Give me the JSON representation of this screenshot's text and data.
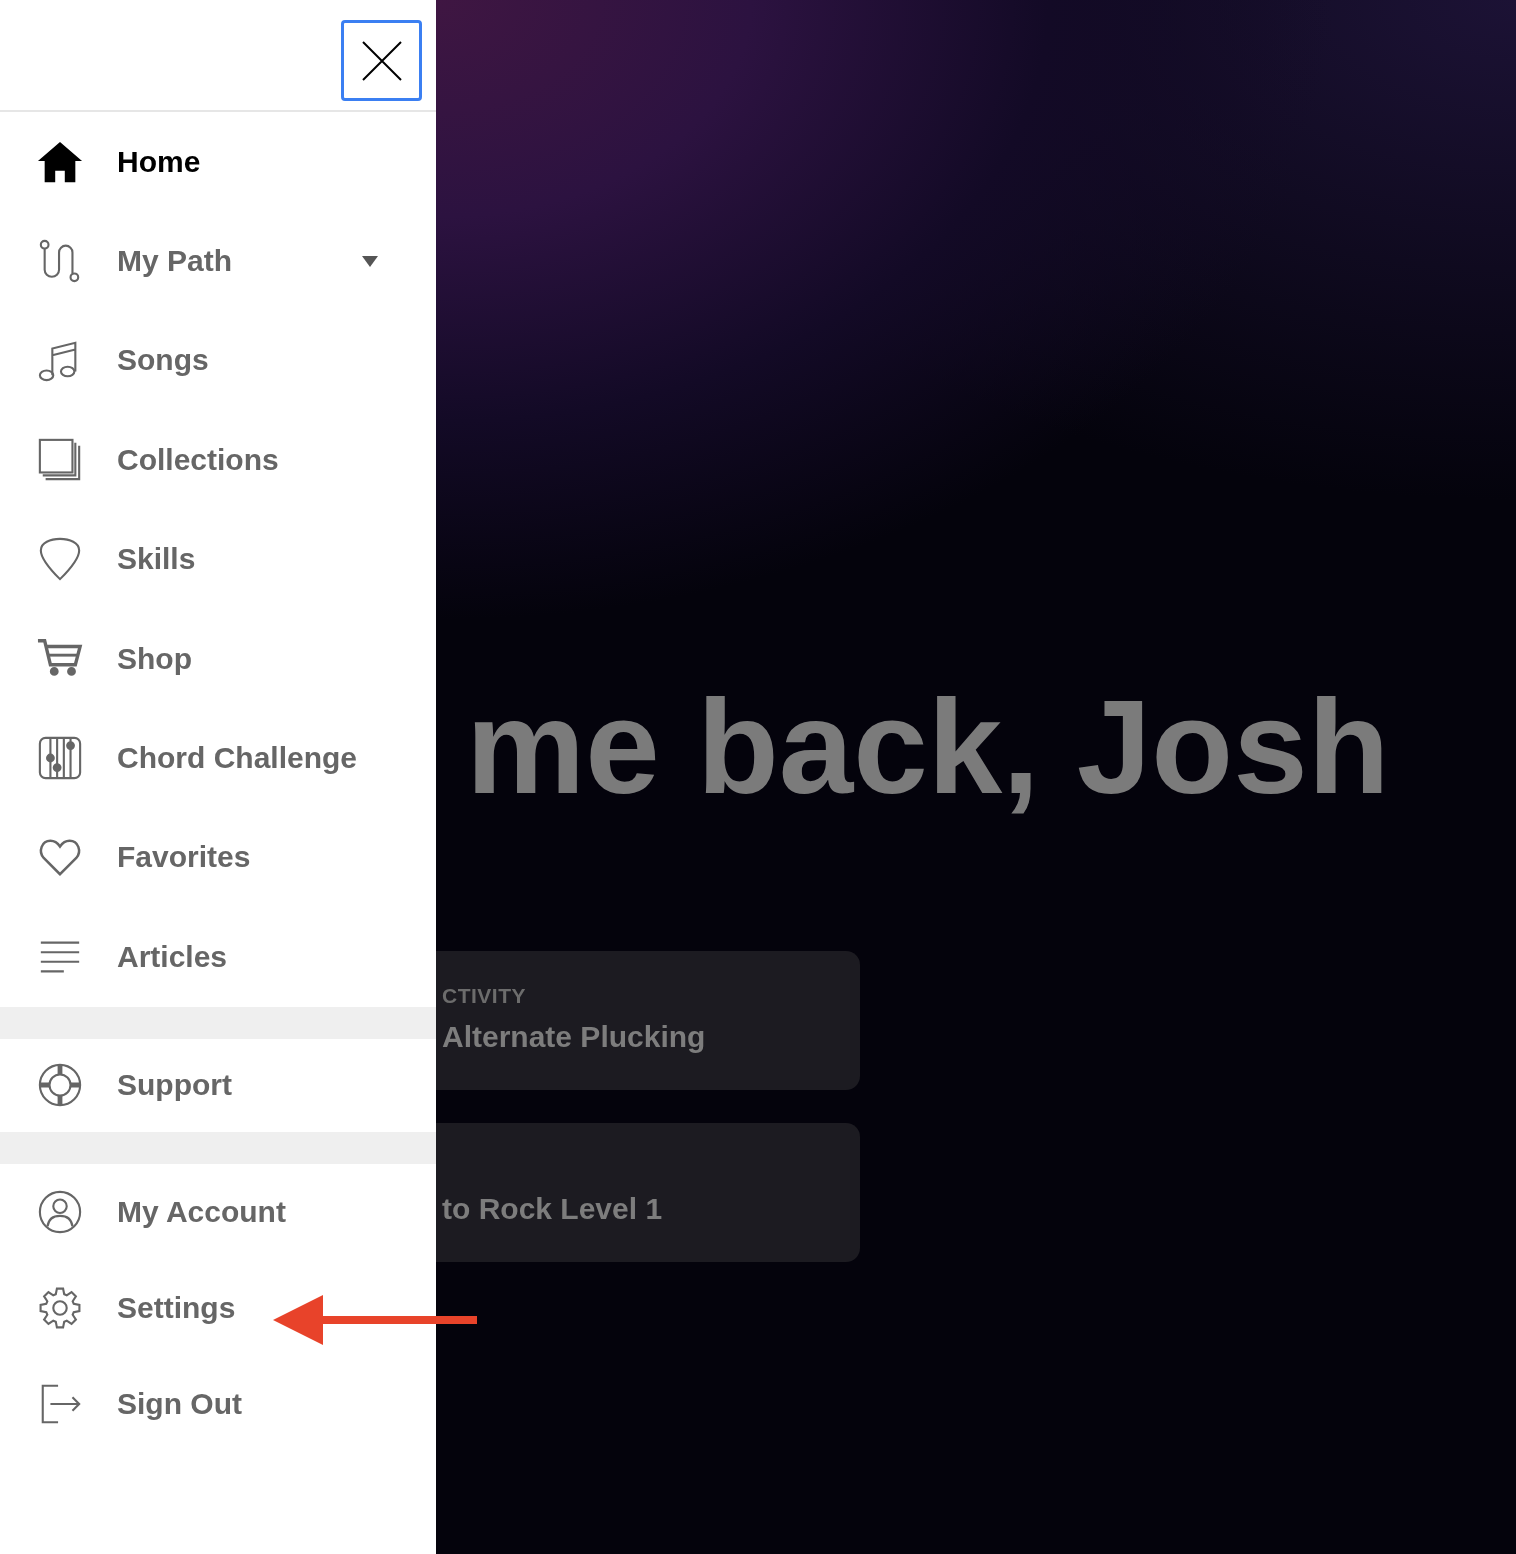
{
  "drawer": {
    "close_button": {
      "focused": true
    },
    "sections": [
      {
        "items": [
          {
            "label": "Home",
            "kind": "link",
            "selected": true
          },
          {
            "label": "My Path",
            "kind": "dropdown",
            "selected": false
          },
          {
            "label": "Songs",
            "kind": "link",
            "selected": false
          },
          {
            "label": "Collections",
            "kind": "link",
            "selected": false
          },
          {
            "label": "Skills",
            "kind": "link",
            "selected": false
          },
          {
            "label": "Shop",
            "kind": "link",
            "selected": false
          },
          {
            "label": "Chord Challenge",
            "kind": "link",
            "selected": false
          },
          {
            "label": "Favorites",
            "kind": "link",
            "selected": false
          },
          {
            "label": "Articles",
            "kind": "link",
            "selected": false
          }
        ]
      },
      {
        "items": [
          {
            "label": "Support",
            "kind": "link",
            "selected": false
          }
        ]
      },
      {
        "items": [
          {
            "label": "My Account",
            "kind": "link",
            "selected": false
          },
          {
            "label": "Settings",
            "kind": "link",
            "selected": false
          },
          {
            "label": "Sign Out",
            "kind": "link",
            "selected": false
          }
        ]
      }
    ]
  },
  "main": {
    "heading": "me back, Josh",
    "cards": [
      {
        "label": "CTIVITY",
        "title": "Alternate Plucking"
      },
      {
        "title": "to Rock Level 1"
      }
    ]
  }
}
